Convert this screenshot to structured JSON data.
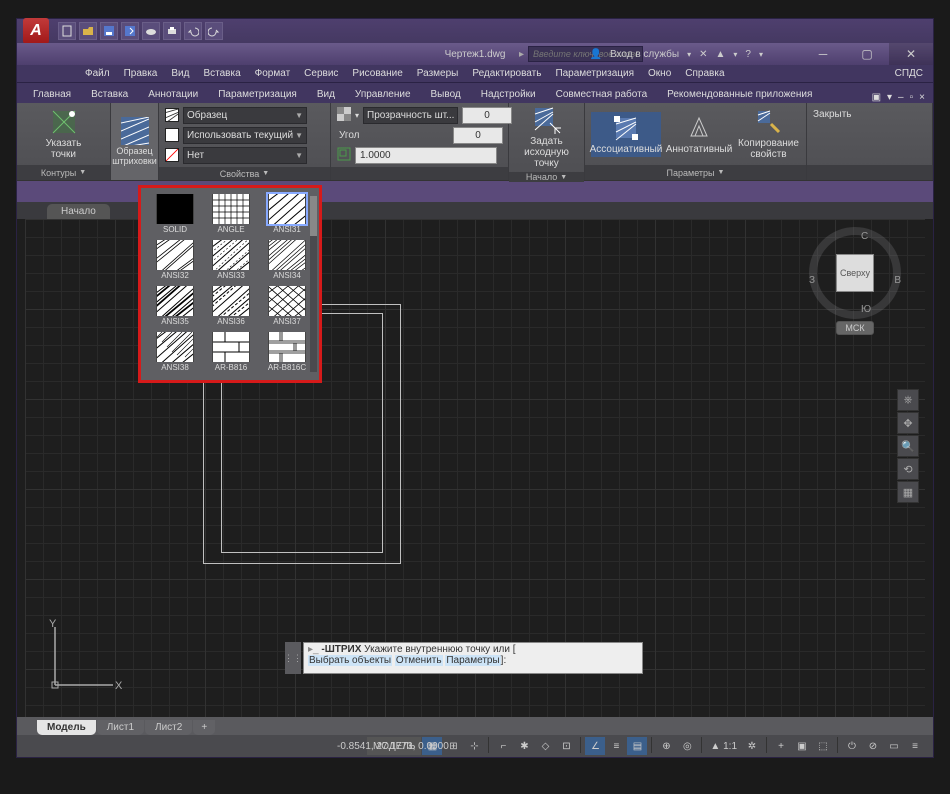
{
  "title": "Чертеж1.dwg",
  "search_placeholder": "Введите ключевое слово/фразу",
  "login_label": "Вход в службы",
  "menubar": [
    "Файл",
    "Правка",
    "Вид",
    "Вставка",
    "Формат",
    "Сервис",
    "Рисование",
    "Размеры",
    "Редактировать",
    "Параметризация",
    "Окно",
    "Справка",
    "СПДС"
  ],
  "tabs": [
    "Главная",
    "Вставка",
    "Аннотации",
    "Параметризация",
    "Вид",
    "Управление",
    "Вывод",
    "Надстройки",
    "Совместная работа",
    "Рекомендованные приложения"
  ],
  "ribbon": {
    "panel1_btn": "Указать точки",
    "panel1_title": "Контуры",
    "panel2_btn": "Образец штриховки",
    "props_label1": "Образец",
    "props_label2": "Использовать текущий",
    "props_label3": "Нет",
    "props_title": "Свойства",
    "transp_label": "Прозрачность шт...",
    "angle_label": "Угол",
    "scale_val": "1.0000",
    "panel4_btn": "Задать исходную точку",
    "panel4_title": "Начало",
    "panel5_a": "Ассоциативный",
    "panel5_b": "Аннотативный",
    "panel5_c": "Копирование свойств",
    "panel5_title": "Параметры",
    "close_btn": "Закрыть"
  },
  "start_tab": "Начало",
  "patterns": [
    {
      "name": "SOLID"
    },
    {
      "name": "ANGLE"
    },
    {
      "name": "ANSI31",
      "sel": true
    },
    {
      "name": "ANSI32"
    },
    {
      "name": "ANSI33"
    },
    {
      "name": "ANSI34"
    },
    {
      "name": "ANSI35"
    },
    {
      "name": "ANSI36"
    },
    {
      "name": "ANSI37"
    },
    {
      "name": "ANSI38"
    },
    {
      "name": "AR-B816"
    },
    {
      "name": "AR-B816C"
    }
  ],
  "viewcube": {
    "face": "Сверху",
    "n": "С",
    "s": "Ю",
    "e": "В",
    "w": "З",
    "label": "МСК"
  },
  "cmd": {
    "cmd": "-ШТРИХ",
    "text": "Укажите внутреннюю точку или [",
    "opt1": "Выбрать объекты",
    "opt2": "Отменить",
    "opt3": "Параметры",
    "end": "]:"
  },
  "layout_tabs": [
    "Модель",
    "Лист1",
    "Лист2"
  ],
  "coords": "-0.8541, 27.1773, 0.0000",
  "model_label": "МОДЕЛЬ",
  "val_zero": "0"
}
